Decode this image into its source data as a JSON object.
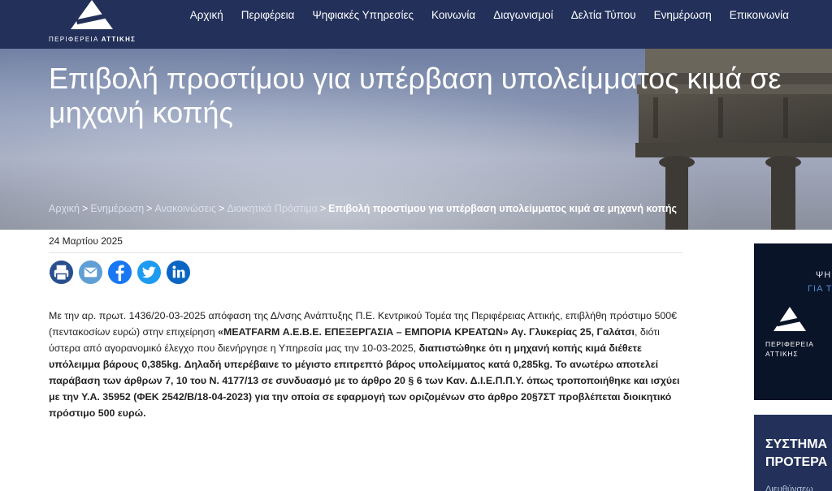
{
  "header": {
    "logo_text_regular": "ΠΕΡΙΦΕΡΕΙΑ",
    "logo_text_bold": "ΑΤΤΙΚΗΣ",
    "nav": [
      "Αρχική",
      "Περιφέρεια",
      "Ψηφιακές Υπηρεσίες",
      "Κοινωνία",
      "Διαγωνισμοί",
      "Δελτία Τύπου",
      "Ενημέρωση",
      "Επικοινωνία"
    ]
  },
  "hero": {
    "title": "Επιβολή προστίμου για υπέρβαση υπολείμματος κιμά σε μηχανή κοπής"
  },
  "breadcrumb": {
    "items": [
      "Αρχική",
      "Ενημέρωση",
      "Ανακοινώσεις",
      "Διοικητικά Πρόστιμα"
    ],
    "separator": ">",
    "current": "Επιβολή προστίμου για υπέρβαση υπολείμματος κιμά σε μηχανή κοπής"
  },
  "article": {
    "date": "24 Μαρτίου 2025",
    "share_icons": [
      "print-icon",
      "email-icon",
      "facebook-icon",
      "twitter-icon",
      "linkedin-icon"
    ],
    "p1": "Με την αρ. πρωτ. 1436/20-03-2025 απόφαση της Δ/νσης Ανάπτυξης Π.Ε. Κεντρικού Τομέα της Περιφέρειας Αττικής, επιβλήθη πρόστιμο 500€ (πεντακοσίων ευρώ) στην επιχείρηση ",
    "b1": "«MEATFARM Α.Ε.Β.Ε. ΕΠΕΞΕΡΓΑΣΙΑ – ΕΜΠΟΡΙΑ ΚΡΕΑΤΩΝ» Αγ. Γλυκερίας 25, Γαλάτσι",
    "p2": ", διότι ύστερα από αγορανομικό έλεγχο που διενήργησε η Υπηρεσία μας την 10-03-2025, ",
    "b2": "διαπιστώθηκε ότι η μηχανή κοπής κιμά διέθετε υπόλειμμα βάρους 0,385kg. Δηλαδή υπερέβαινε το μέγιστο επιτρεπτό βάρος υπολείμματος κατά 0,285kg. Το ανωτέρω αποτελεί παράβαση των άρθρων 7, 10 του Ν. 4177/13 σε συνδυασμό με το άρθρο 20 § 6 των Καν. Δ.Ι.Ε.Π.Π.Υ. όπως τροποποιήθηκε και ισχύει με την Υ.Α. 35952 (ΦΕΚ 2542/Β/18-04-2023) για την οποία σε εφαρμογή των οριζομένων στο άρθρο 20§7ΣΤ προβλέπεται διοικητικό πρόστιμο 500 ευρώ."
  },
  "sidebar": {
    "banner1_line1": "ΨΗ",
    "banner1_line2": "ΓΙΑ Τ",
    "banner1_label_1": "ΠΕΡΙΦΕΡΕΙΑ",
    "banner1_label_2": "ΑΤΤΙΚΗΣ",
    "banner2_line1": "ΣΥΣΤΗΜΑ",
    "banner2_line2": "ΠΡΟΤΕΡΑ",
    "banner2_sub": "Διευθύνσεω"
  },
  "colors": {
    "header_bg": "#22305a",
    "hero_text": "#ffffff",
    "banner_dark": "#0a1428"
  }
}
